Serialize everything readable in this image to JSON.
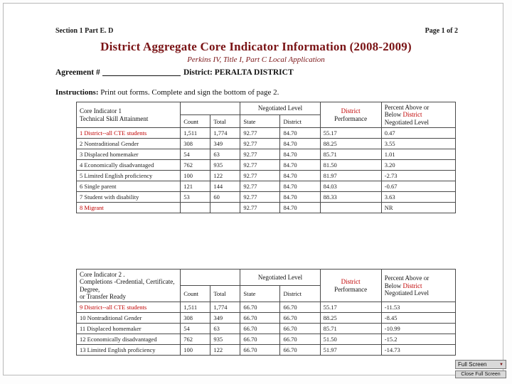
{
  "header": {
    "left": "Section 1 Part E. D",
    "right": "Page 1 of 2"
  },
  "title": "District Aggregate Core Indicator Information (2008-2009)",
  "subtitle": "Perkins IV, Title I, Part C Local Application",
  "agreement": {
    "label": "Agreement #",
    "district_label": "District:",
    "district_value": "PERALTA DISTRICT"
  },
  "instructions": {
    "label": "Instructions:",
    "text": "Print out forms. Complete and sign the bottom of page 2."
  },
  "tables": [
    {
      "indicator_title_line1": "Core Indicator 1",
      "indicator_title_line2": "Technical Skill Attainment",
      "negotiated_header": "Negotiated  Level",
      "performance_header_red": "District",
      "performance_header": "Performance",
      "above_below_line1": "Percent Above or",
      "above_below_red": "District",
      "above_below_line2": "Below",
      "above_below_line3": "Negotiated Level",
      "sub_count": "Count",
      "sub_total": "Total",
      "sub_state": "State",
      "sub_district": "District",
      "rows": [
        {
          "label": "1 District--all CTE students",
          "red": true,
          "count": "1,511",
          "total": "1,774",
          "state": "92.77",
          "district": "84.70",
          "performance": "55.17",
          "above": "0.47"
        },
        {
          "label": "2 Nontraditional Gender",
          "red": false,
          "count": "308",
          "total": "349",
          "state": "92.77",
          "district": "84.70",
          "performance": "88.25",
          "above": "3.55"
        },
        {
          "label": "3 Displaced homemaker",
          "red": false,
          "count": "54",
          "total": "63",
          "state": "92.77",
          "district": "84.70",
          "performance": "85.71",
          "above": "1.01"
        },
        {
          "label": "4 Economically disadvantaged",
          "red": false,
          "count": "762",
          "total": "935",
          "state": "92.77",
          "district": "84.70",
          "performance": "81.50",
          "above": "3.20"
        },
        {
          "label": "5 Limited English proficiency",
          "red": false,
          "count": "100",
          "total": "122",
          "state": "92.77",
          "district": "84.70",
          "performance": "81.97",
          "above": "-2.73"
        },
        {
          "label": "6 Single parent",
          "red": false,
          "count": "121",
          "total": "144",
          "state": "92.77",
          "district": "84.70",
          "performance": "84.03",
          "above": "-0.67"
        },
        {
          "label": "7 Student with disability",
          "red": false,
          "count": "53",
          "total": "60",
          "state": "92.77",
          "district": "84.70",
          "performance": "88.33",
          "above": "3.63"
        },
        {
          "label": "8 Migrant",
          "red": true,
          "count": "",
          "total": "",
          "state": "92.77",
          "district": "84.70",
          "performance": "",
          "above": "NR"
        }
      ]
    },
    {
      "indicator_title_line1": "Core Indicator 2 .",
      "indicator_title_line2": "Completions -Credential, Certificate, Degree,",
      "indicator_title_line3": "or Transfer Ready",
      "negotiated_header": "Negotiated  Level",
      "performance_header_red": "District",
      "performance_header": "Performance",
      "above_below_line1": "Percent Above or",
      "above_below_red": "District",
      "above_below_line2": "Below",
      "above_below_line3": "Negotiated Level",
      "sub_count": "Count",
      "sub_total": "Total",
      "sub_state": "State",
      "sub_district": "District",
      "rows": [
        {
          "label": "9 District--all CTE students",
          "red": true,
          "count": "1,511",
          "total": "1,774",
          "state": "66.70",
          "district": "66.70",
          "performance": "55.17",
          "above": "-11.53"
        },
        {
          "label": "10 Nontraditional Gender",
          "red": false,
          "count": "308",
          "total": "349",
          "state": "66.70",
          "district": "66.70",
          "performance": "88.25",
          "above": "-8.45"
        },
        {
          "label": "11 Displaced homemaker",
          "red": false,
          "count": "54",
          "total": "63",
          "state": "66.70",
          "district": "66.70",
          "performance": "85.71",
          "above": "-10.99"
        },
        {
          "label": "12 Economically disadvantaged",
          "red": false,
          "count": "762",
          "total": "935",
          "state": "66.70",
          "district": "66.70",
          "performance": "51.50",
          "above": "-15.2"
        },
        {
          "label": "13 Limited English proficiency",
          "red": false,
          "count": "100",
          "total": "122",
          "state": "66.70",
          "district": "66.70",
          "performance": "51.97",
          "above": "-14.73"
        }
      ]
    }
  ],
  "controls": {
    "full_screen": "Full Screen",
    "close_full_screen": "Close Full Screen",
    "dropdown_arrow": "▼"
  }
}
